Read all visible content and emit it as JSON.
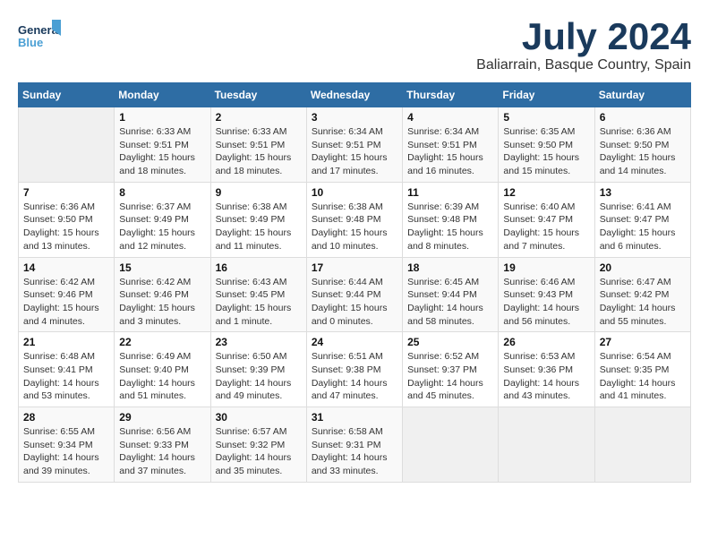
{
  "logo": {
    "text_general": "General",
    "text_blue": "Blue"
  },
  "title": "July 2024",
  "location": "Baliarrain, Basque Country, Spain",
  "days_header": [
    "Sunday",
    "Monday",
    "Tuesday",
    "Wednesday",
    "Thursday",
    "Friday",
    "Saturday"
  ],
  "weeks": [
    [
      {
        "day": "",
        "info": ""
      },
      {
        "day": "1",
        "info": "Sunrise: 6:33 AM\nSunset: 9:51 PM\nDaylight: 15 hours\nand 18 minutes."
      },
      {
        "day": "2",
        "info": "Sunrise: 6:33 AM\nSunset: 9:51 PM\nDaylight: 15 hours\nand 18 minutes."
      },
      {
        "day": "3",
        "info": "Sunrise: 6:34 AM\nSunset: 9:51 PM\nDaylight: 15 hours\nand 17 minutes."
      },
      {
        "day": "4",
        "info": "Sunrise: 6:34 AM\nSunset: 9:51 PM\nDaylight: 15 hours\nand 16 minutes."
      },
      {
        "day": "5",
        "info": "Sunrise: 6:35 AM\nSunset: 9:50 PM\nDaylight: 15 hours\nand 15 minutes."
      },
      {
        "day": "6",
        "info": "Sunrise: 6:36 AM\nSunset: 9:50 PM\nDaylight: 15 hours\nand 14 minutes."
      }
    ],
    [
      {
        "day": "7",
        "info": "Sunrise: 6:36 AM\nSunset: 9:50 PM\nDaylight: 15 hours\nand 13 minutes."
      },
      {
        "day": "8",
        "info": "Sunrise: 6:37 AM\nSunset: 9:49 PM\nDaylight: 15 hours\nand 12 minutes."
      },
      {
        "day": "9",
        "info": "Sunrise: 6:38 AM\nSunset: 9:49 PM\nDaylight: 15 hours\nand 11 minutes."
      },
      {
        "day": "10",
        "info": "Sunrise: 6:38 AM\nSunset: 9:48 PM\nDaylight: 15 hours\nand 10 minutes."
      },
      {
        "day": "11",
        "info": "Sunrise: 6:39 AM\nSunset: 9:48 PM\nDaylight: 15 hours\nand 8 minutes."
      },
      {
        "day": "12",
        "info": "Sunrise: 6:40 AM\nSunset: 9:47 PM\nDaylight: 15 hours\nand 7 minutes."
      },
      {
        "day": "13",
        "info": "Sunrise: 6:41 AM\nSunset: 9:47 PM\nDaylight: 15 hours\nand 6 minutes."
      }
    ],
    [
      {
        "day": "14",
        "info": "Sunrise: 6:42 AM\nSunset: 9:46 PM\nDaylight: 15 hours\nand 4 minutes."
      },
      {
        "day": "15",
        "info": "Sunrise: 6:42 AM\nSunset: 9:46 PM\nDaylight: 15 hours\nand 3 minutes."
      },
      {
        "day": "16",
        "info": "Sunrise: 6:43 AM\nSunset: 9:45 PM\nDaylight: 15 hours\nand 1 minute."
      },
      {
        "day": "17",
        "info": "Sunrise: 6:44 AM\nSunset: 9:44 PM\nDaylight: 15 hours\nand 0 minutes."
      },
      {
        "day": "18",
        "info": "Sunrise: 6:45 AM\nSunset: 9:44 PM\nDaylight: 14 hours\nand 58 minutes."
      },
      {
        "day": "19",
        "info": "Sunrise: 6:46 AM\nSunset: 9:43 PM\nDaylight: 14 hours\nand 56 minutes."
      },
      {
        "day": "20",
        "info": "Sunrise: 6:47 AM\nSunset: 9:42 PM\nDaylight: 14 hours\nand 55 minutes."
      }
    ],
    [
      {
        "day": "21",
        "info": "Sunrise: 6:48 AM\nSunset: 9:41 PM\nDaylight: 14 hours\nand 53 minutes."
      },
      {
        "day": "22",
        "info": "Sunrise: 6:49 AM\nSunset: 9:40 PM\nDaylight: 14 hours\nand 51 minutes."
      },
      {
        "day": "23",
        "info": "Sunrise: 6:50 AM\nSunset: 9:39 PM\nDaylight: 14 hours\nand 49 minutes."
      },
      {
        "day": "24",
        "info": "Sunrise: 6:51 AM\nSunset: 9:38 PM\nDaylight: 14 hours\nand 47 minutes."
      },
      {
        "day": "25",
        "info": "Sunrise: 6:52 AM\nSunset: 9:37 PM\nDaylight: 14 hours\nand 45 minutes."
      },
      {
        "day": "26",
        "info": "Sunrise: 6:53 AM\nSunset: 9:36 PM\nDaylight: 14 hours\nand 43 minutes."
      },
      {
        "day": "27",
        "info": "Sunrise: 6:54 AM\nSunset: 9:35 PM\nDaylight: 14 hours\nand 41 minutes."
      }
    ],
    [
      {
        "day": "28",
        "info": "Sunrise: 6:55 AM\nSunset: 9:34 PM\nDaylight: 14 hours\nand 39 minutes."
      },
      {
        "day": "29",
        "info": "Sunrise: 6:56 AM\nSunset: 9:33 PM\nDaylight: 14 hours\nand 37 minutes."
      },
      {
        "day": "30",
        "info": "Sunrise: 6:57 AM\nSunset: 9:32 PM\nDaylight: 14 hours\nand 35 minutes."
      },
      {
        "day": "31",
        "info": "Sunrise: 6:58 AM\nSunset: 9:31 PM\nDaylight: 14 hours\nand 33 minutes."
      },
      {
        "day": "",
        "info": ""
      },
      {
        "day": "",
        "info": ""
      },
      {
        "day": "",
        "info": ""
      }
    ]
  ]
}
